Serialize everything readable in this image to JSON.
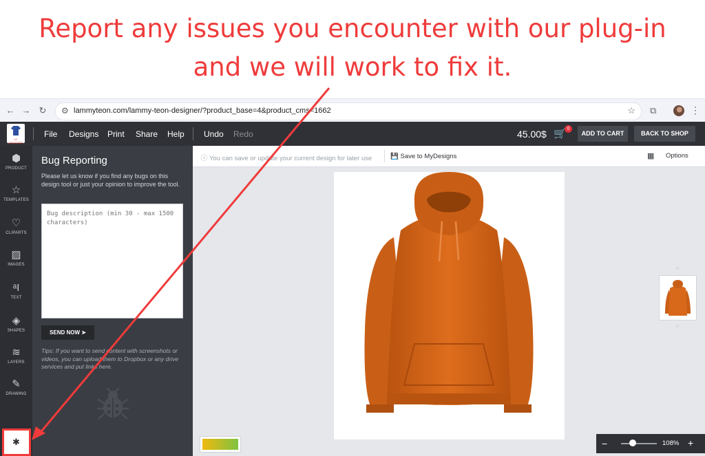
{
  "headline": {
    "line1": "Report any issues you encounter with our plug-in",
    "line2": "and we will work to fix it."
  },
  "browser": {
    "back_icon": "←",
    "forward_icon": "→",
    "reload_icon": "↻",
    "site_settings_icon": "⚙",
    "url": "lammyteon.com/lammy-teon-designer/?product_base=4&product_cms=1662",
    "bookmark_icon": "☆",
    "extensions_icon": "⧉",
    "menu_icon": "⋮"
  },
  "topbar": {
    "logo_text": "LT DESIGNER",
    "menu": [
      "File",
      "Designs",
      "Print",
      "Share",
      "Help"
    ],
    "undo": "Undo",
    "redo": "Redo",
    "price": "45.00$",
    "cart_icon": "🛒",
    "cart_count": "0",
    "add_to_cart": "ADD TO CART",
    "back_to_shop": "BACK TO SHOP"
  },
  "leftnav": [
    {
      "label": "PRODUCT",
      "icon": "⬢"
    },
    {
      "label": "TEMPLATES",
      "icon": "☆"
    },
    {
      "label": "CLIPARTS",
      "icon": "♡"
    },
    {
      "label": "IMAGES",
      "icon": "▨"
    },
    {
      "label": "TEXT",
      "icon": "ᵃI"
    },
    {
      "label": "SHAPES",
      "icon": "◈"
    },
    {
      "label": "LAYERS",
      "icon": "≋"
    },
    {
      "label": "DRAWING",
      "icon": "✎"
    }
  ],
  "bug_nav_icon": "✱",
  "panel": {
    "title": "Bug Reporting",
    "description": "Please let us know if you find any bugs on this design tool or just your opinion to improve the tool.",
    "placeholder": "Bug description (min 30 - max 1500 characters)",
    "send_label": "SEND NOW ➤",
    "tips": "Tips: If you want to send content with screenshots or videos, you can upload them to Dropbox or any drive services and put links here."
  },
  "canvas": {
    "save_hint": "You can save or update your current design for later use",
    "save_label": "Save to MyDesigns",
    "options_label": "Options",
    "zoom_minus": "−",
    "zoom_level": "108%",
    "zoom_plus": "+"
  },
  "colors": {
    "headline": "#ef3b3b",
    "hoodie": "#d8681a",
    "topbar": "#2f3136",
    "panel": "#3a3d43",
    "swatch_start": "#f0b90e",
    "swatch_end": "#7fc241"
  }
}
